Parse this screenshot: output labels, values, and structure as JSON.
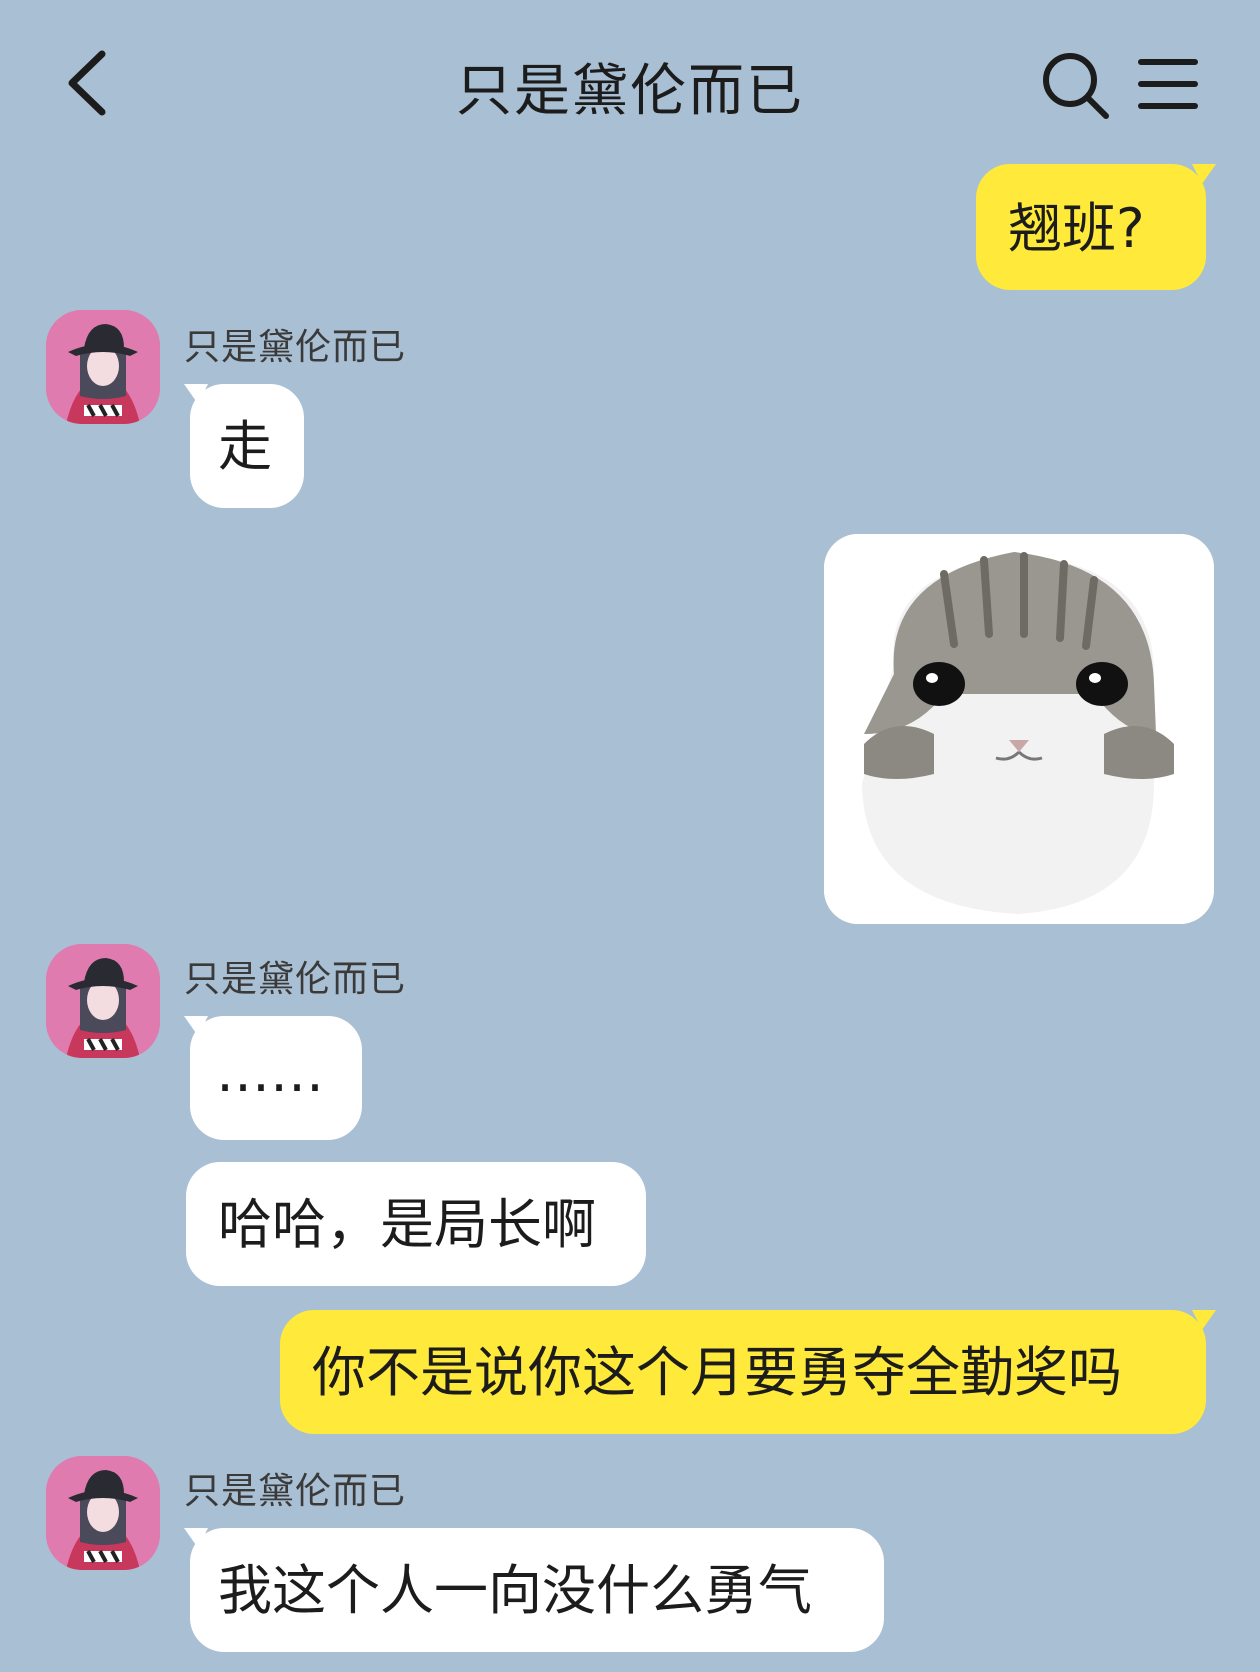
{
  "header": {
    "title": "只是黛伦而已",
    "back_icon": "chevron-left-icon",
    "search_icon": "search-icon",
    "menu_icon": "hamburger-menu-icon"
  },
  "colors": {
    "background": "#a9bfd3",
    "my_bubble": "#ffe93a",
    "other_bubble": "#ffffff",
    "avatar_bg": "#e07bb0"
  },
  "messages": [
    {
      "from": "me",
      "type": "text",
      "text": "翘班?"
    },
    {
      "from": "other",
      "sender": "只是黛伦而已",
      "type": "text",
      "text": "走"
    },
    {
      "from": "me",
      "type": "sticker",
      "sticker": "crying-cat-sticker"
    },
    {
      "from": "other",
      "sender": "只是黛伦而已",
      "type": "text",
      "text": "……"
    },
    {
      "from": "other",
      "type": "text",
      "text": "哈哈，是局长啊"
    },
    {
      "from": "me",
      "type": "text",
      "text": "你不是说你这个月要勇夺全勤奖吗"
    },
    {
      "from": "other",
      "sender": "只是黛伦而已",
      "type": "text",
      "text": "我这个人一向没什么勇气"
    }
  ]
}
